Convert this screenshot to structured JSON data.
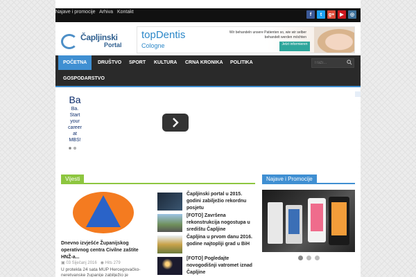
{
  "topbar": {
    "links": [
      "Najave i promocije",
      "Arhiva",
      "Kontakt"
    ]
  },
  "social_icons": [
    {
      "name": "facebook-icon",
      "glyph": "f",
      "color": "#3b5998"
    },
    {
      "name": "twitter-icon",
      "glyph": "t",
      "color": "#1da1f2"
    },
    {
      "name": "googleplus-icon",
      "glyph": "g+",
      "color": "#dd4b39"
    },
    {
      "name": "youtube-icon",
      "glyph": "▶",
      "color": "#cc181e"
    },
    {
      "name": "instagram-icon",
      "glyph": "◎",
      "color": "#3f729b"
    }
  ],
  "logo": {
    "line1": "Čapljinski",
    "line2": "Portal"
  },
  "banner": {
    "brand_top": "topDentis",
    "brand_bottom": "Cologne",
    "tagline": "Wir behandeln unsere Patienten so, wie wir selber behandelt werden möchten",
    "cta": "Jetzt informieren"
  },
  "nav": {
    "items": [
      "POČETNA",
      "DRUŠTVO",
      "SPORT",
      "KULTURA",
      "CRNA KRONIKA",
      "POLITIKA",
      "GOSPODARSTVO"
    ],
    "search_placeholder": "Traži..."
  },
  "ad": {
    "title": "Ba",
    "text": "Ba. Start your career at MBS!"
  },
  "sections": {
    "news": "Vijesti",
    "promo": "Najave i Promocije"
  },
  "featured": {
    "title": "Dnevno izvješće Županijskog operativnog centra Civilne zaštite HNŽ-a...",
    "date": "03 Siječanj 2016",
    "hits": "Hits 279",
    "excerpt": "U protekla 24 sata MUP Hercegovačko-neretvanske županije zabilježio je"
  },
  "news": [
    {
      "title": "Čapljinski portal u 2015. godini zabilježio rekordnu posjetu"
    },
    {
      "title": "[FOTO] Završena rekonstrukcija nogostupa u središtu Čapljine"
    },
    {
      "title": "Čapljina u prvom danu 2016. godine najtopliji grad u BiH"
    },
    {
      "title": "[FOTO] Pogledajte novogodišnji vatromet iznad Čapljine"
    }
  ]
}
